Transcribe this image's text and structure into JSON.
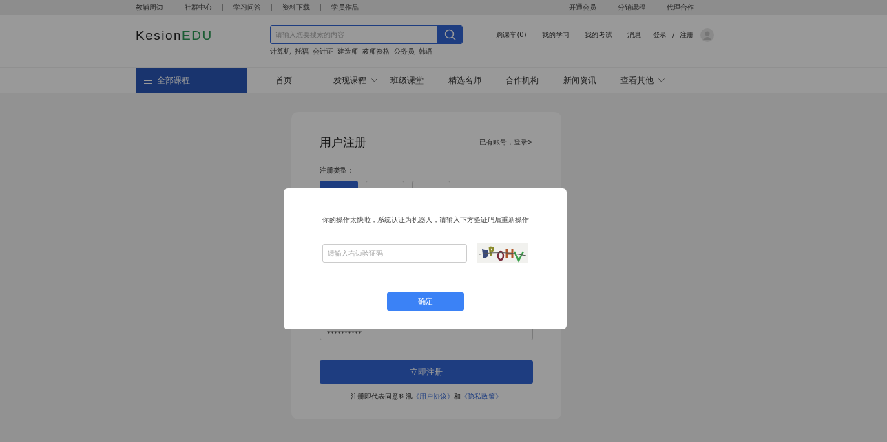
{
  "top_bar": {
    "left_links": [
      "教辅周边",
      "社群中心",
      "学习问答",
      "资料下载",
      "学员作品"
    ],
    "right_links": [
      "开通会员",
      "分销课程",
      "代理合作"
    ]
  },
  "header": {
    "logo": {
      "part_1": "Kesion",
      "part_2": "EDU"
    },
    "search": {
      "placeholder": "请输入您要搜索的内容"
    },
    "hot_keywords": [
      "计算机",
      "托福",
      "会计证",
      "建造师",
      "教师资格",
      "公务员",
      "韩语"
    ],
    "user_links": [
      "购课车(0)",
      "我的学习",
      "我的考试",
      "消息"
    ],
    "login": "登录",
    "separator": "/",
    "register": "注册"
  },
  "nav": {
    "all_courses": "全部课程",
    "items": [
      {
        "label": "首页",
        "dropdown": false
      },
      {
        "label": "发现课程",
        "dropdown": true
      },
      {
        "label": "班级课堂",
        "dropdown": false
      },
      {
        "label": "精选名师",
        "dropdown": false
      },
      {
        "label": "合作机构",
        "dropdown": false
      },
      {
        "label": "新闻资讯",
        "dropdown": false
      },
      {
        "label": "查看其他",
        "dropdown": true
      }
    ]
  },
  "register_card": {
    "title": "用户注册",
    "login_link": "已有账号，登录>",
    "type_label": "注册类型：",
    "types": [
      {
        "selected": true
      },
      {
        "selected": false
      },
      {
        "selected": false
      }
    ],
    "password": {
      "value": "**********"
    },
    "submit": "立即注册",
    "agreement": {
      "prefix": "注册即代表同意科汛",
      "links": [
        "《用户协议》",
        "《隐私政策》"
      ],
      "joiner": "和"
    }
  },
  "dialog": {
    "message": "你的操作太快啦，系统认证为机器人，请输入下方验证码后重新操作",
    "captcha_field": {
      "placeholder": "请输入右边验证码"
    },
    "confirm": "确定"
  }
}
